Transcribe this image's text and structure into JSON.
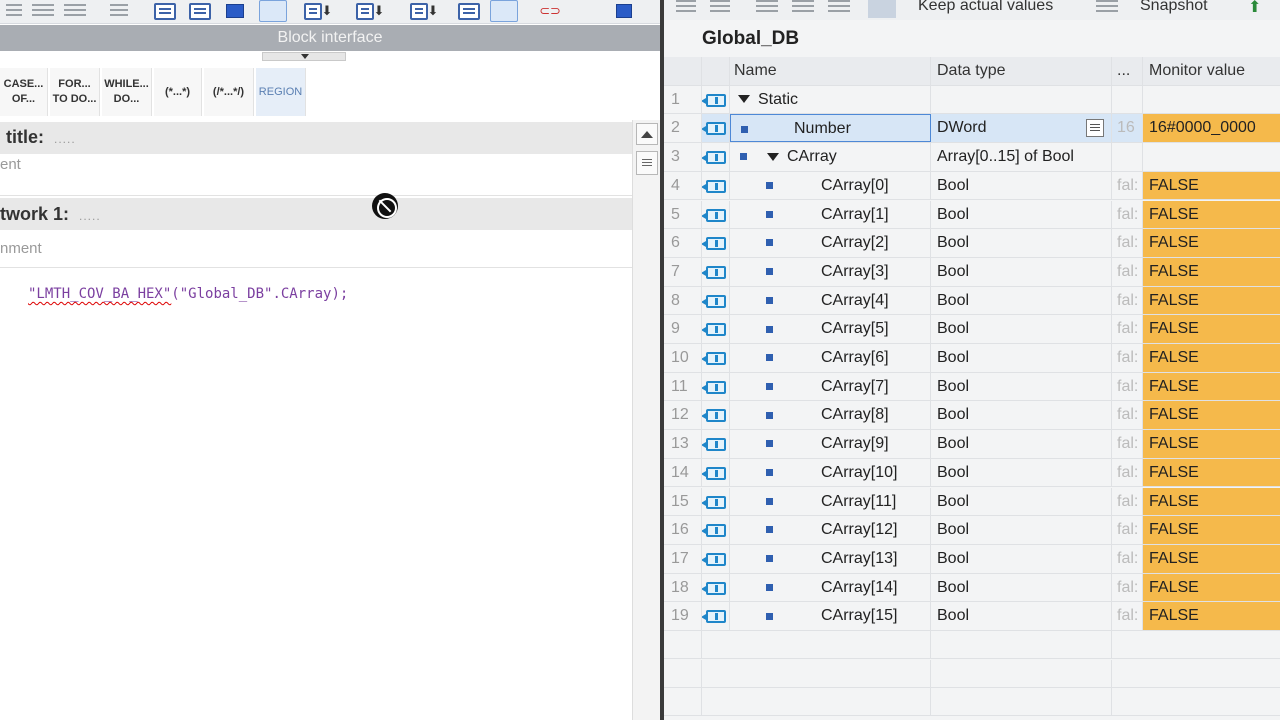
{
  "left": {
    "block_interface_label": "Block interface",
    "snippets": [
      "CASE... OF...",
      "FOR... TO DO...",
      "WHILE... DO...",
      "(*...*)",
      "(/*...*/)",
      "REGION"
    ],
    "block_title_label": "title:",
    "block_comment": "ent",
    "network_label": "twork 1:",
    "network_comment": "nment",
    "dots": ".....",
    "code": {
      "function_name": "\"LMTH_COV_BA_HEX\"",
      "rest": "(\"Global_DB\".CArray);"
    }
  },
  "right": {
    "toolbar": {
      "keep_actual_values": "Keep actual values",
      "snapshot": "Snapshot"
    },
    "db_name": "Global_DB",
    "columns": {
      "name": "Name",
      "data_type": "Data type",
      "dots": "...",
      "monitor_value": "Monitor value"
    },
    "rows": [
      {
        "num": "1",
        "name": "Static",
        "type": "",
        "extra": "",
        "monitor": ""
      },
      {
        "num": "2",
        "name": "Number",
        "type": "DWord",
        "extra": "16",
        "monitor": "16#0000_0000"
      },
      {
        "num": "3",
        "name": "CArray",
        "type": "Array[0..15] of Bool",
        "extra": "",
        "monitor": ""
      },
      {
        "num": "4",
        "name": "CArray[0]",
        "type": "Bool",
        "extra": "fal:",
        "monitor": "FALSE"
      },
      {
        "num": "5",
        "name": "CArray[1]",
        "type": "Bool",
        "extra": "fal:",
        "monitor": "FALSE"
      },
      {
        "num": "6",
        "name": "CArray[2]",
        "type": "Bool",
        "extra": "fal:",
        "monitor": "FALSE"
      },
      {
        "num": "7",
        "name": "CArray[3]",
        "type": "Bool",
        "extra": "fal:",
        "monitor": "FALSE"
      },
      {
        "num": "8",
        "name": "CArray[4]",
        "type": "Bool",
        "extra": "fal:",
        "monitor": "FALSE"
      },
      {
        "num": "9",
        "name": "CArray[5]",
        "type": "Bool",
        "extra": "fal:",
        "monitor": "FALSE"
      },
      {
        "num": "10",
        "name": "CArray[6]",
        "type": "Bool",
        "extra": "fal:",
        "monitor": "FALSE"
      },
      {
        "num": "11",
        "name": "CArray[7]",
        "type": "Bool",
        "extra": "fal:",
        "monitor": "FALSE"
      },
      {
        "num": "12",
        "name": "CArray[8]",
        "type": "Bool",
        "extra": "fal:",
        "monitor": "FALSE"
      },
      {
        "num": "13",
        "name": "CArray[9]",
        "type": "Bool",
        "extra": "fal:",
        "monitor": "FALSE"
      },
      {
        "num": "14",
        "name": "CArray[10]",
        "type": "Bool",
        "extra": "fal:",
        "monitor": "FALSE"
      },
      {
        "num": "15",
        "name": "CArray[11]",
        "type": "Bool",
        "extra": "fal:",
        "monitor": "FALSE"
      },
      {
        "num": "16",
        "name": "CArray[12]",
        "type": "Bool",
        "extra": "fal:",
        "monitor": "FALSE"
      },
      {
        "num": "17",
        "name": "CArray[13]",
        "type": "Bool",
        "extra": "fal:",
        "monitor": "FALSE"
      },
      {
        "num": "18",
        "name": "CArray[14]",
        "type": "Bool",
        "extra": "fal:",
        "monitor": "FALSE"
      },
      {
        "num": "19",
        "name": "CArray[15]",
        "type": "Bool",
        "extra": "fal:",
        "monitor": "FALSE"
      }
    ]
  },
  "colors": {
    "monitor_highlight": "#f5b94b",
    "selection": "#d7e6f6",
    "code": "#7b3fa0"
  }
}
